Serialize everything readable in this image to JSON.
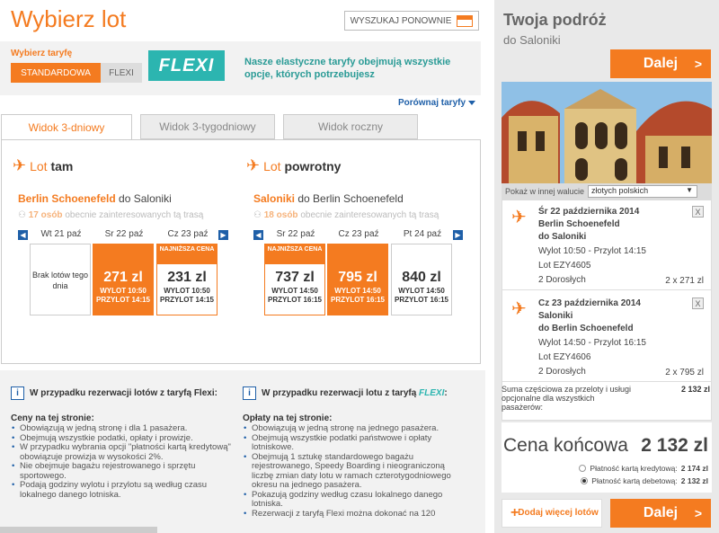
{
  "header": {
    "title": "Wybierz lot",
    "search_again": "WYSZUKAJ PONOWNIE"
  },
  "fare": {
    "label": "Wybierz taryfę",
    "standard": "STANDARDOWA",
    "flexi": "FLEXI",
    "flexi_logo": "FLEXI",
    "flexi_text": "Nasze elastyczne taryfy obejmują wszystkie opcje, których potrzebujesz",
    "compare": "Porównaj taryfy"
  },
  "tabs": [
    "Widok 3-dniowy",
    "Widok 3-tygodniowy",
    "Widok roczny"
  ],
  "outbound": {
    "title_lot": "Lot",
    "title_rest": "tam",
    "from": "Berlin Schoenefeld",
    "to_text": "do Saloniki",
    "interest_count": "17 osób",
    "interest_rest": "obecnie zainteresowanych tą trasą",
    "days": [
      {
        "date": "Wt 21 paź",
        "empty": "Brak lotów tego dnia"
      },
      {
        "date": "Sr 22 paź",
        "price": "271 zl",
        "times": "WYLOT 10:50 PRZYLOT 14:15"
      },
      {
        "date": "Cz 23 paź",
        "badge": "NAJNIŻSZA CENA",
        "price": "231 zl",
        "times": "WYLOT 10:50 PRZYLOT 14:15"
      }
    ]
  },
  "return": {
    "title_lot": "Lot",
    "title_rest": "powrotny",
    "from": "Saloniki",
    "to_text": "do Berlin Schoenefeld",
    "interest_count": "18 osób",
    "interest_rest": "obecnie zainteresowanych tą trasą",
    "days": [
      {
        "date": "Sr 22 paź",
        "badge": "NAJNIŻSZA CENA",
        "price": "737 zl",
        "times": "WYLOT 14:50 PRZYLOT 16:15"
      },
      {
        "date": "Cz 23 paź",
        "price": "795 zl",
        "times": "WYLOT 14:50 PRZYLOT 16:15"
      },
      {
        "date": "Pt 24 paź",
        "price": "840 zl",
        "times": "WYLOT 14:50 PRZYLOT 16:15"
      }
    ]
  },
  "info_left": {
    "title": "W przypadku rezerwacji lotów z taryfą Flexi:",
    "heading": "Ceny na tej stronie:",
    "items": [
      "Obowiązują w jedną stronę i dla 1 pasażera.",
      "Obejmują wszystkie podatki, opłaty i prowizje.",
      "W przypadku wybrania opcji \"płatności kartą kredytową\" obowiązuje prowizja w wysokości 2%.",
      "Nie obejmuje bagażu rejestrowanego i sprzętu sportowego.",
      "Podają godziny wylotu i przylotu są według czasu lokalnego danego lotniska."
    ]
  },
  "info_right": {
    "title_pre": "W przypadku rezerwacji lotu z taryfą",
    "title_brand": "FLEXI",
    "title_post": ":",
    "heading": "Opłaty na tej stronie:",
    "items": [
      "Obowiązują w jedną stronę na jednego pasażera.",
      "Obejmują wszystkie podatki państwowe i opłaty lotniskowe.",
      "Obejmują 1 sztukę standardowego bagażu rejestrowanego, Speedy Boarding i nieograniczoną liczbę zmian daty lotu w ramach czterotygodniowego okresu na jednego pasażera.",
      "Pokazują godziny według czasu lokalnego danego lotniska.",
      "Rezerwacji z taryfą Flexi można dokonać na 120"
    ]
  },
  "sidebar": {
    "title": "Twoja podróż",
    "subtitle": "do Saloniki",
    "next": "Dalej",
    "currency_label": "Pokaż w innej walucie",
    "currency_value": "złotych polskich",
    "segments": [
      {
        "date": "Śr 22 października 2014",
        "from": "Berlin Schoenefeld",
        "to": "do Saloniki",
        "times": "Wylot 10:50 - Przylot 14:15",
        "flight": "Lot EZY4605",
        "pax": "2 Dorosłych",
        "price": "2 x 271 zl"
      },
      {
        "date": "Cz 23 października 2014",
        "from": "Saloniki",
        "to": "do Berlin Schoenefeld",
        "times": "Wylot 14:50 - Przylot 16:15",
        "flight": "Lot EZY4606",
        "pax": "2 Dorosłych",
        "price": "2 x 795 zl"
      }
    ],
    "subtotal_label": "Suma częściowa za przeloty i usługi opcjonalne dla wszystkich pasażerów:",
    "subtotal": "2 132 zl",
    "total_label": "Cena końcowa",
    "total": "2 132 zl",
    "pay_credit": "Płatność kartą kredytową:",
    "pay_credit_v": "2 174 zl",
    "pay_debit": "Płatność kartą debetową:",
    "pay_debit_v": "2 132 zl",
    "add_more": "Dodaj więcej lotów"
  },
  "colors": {
    "accent": "#f47b20",
    "flexi": "#2cb5b0",
    "link": "#1e5fa8"
  }
}
